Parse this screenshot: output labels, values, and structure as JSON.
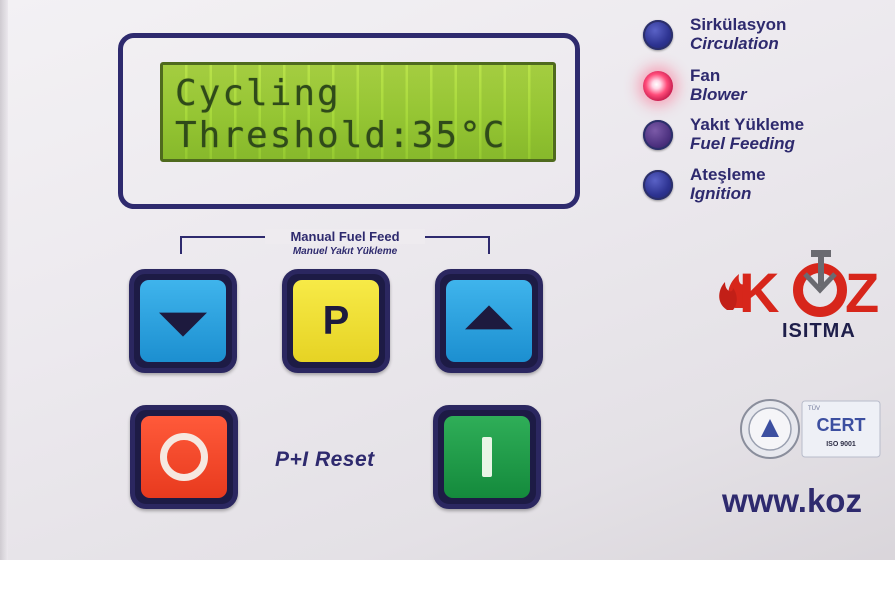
{
  "lcd": {
    "line1": "Cycling",
    "line2": "Threshold:35°C"
  },
  "indicators": [
    {
      "tr": "Sirkülasyon",
      "en": "Circulation",
      "state": "off",
      "color": "#2d3391"
    },
    {
      "tr": "Fan",
      "en": "Blower",
      "state": "on",
      "color": "#ff4c7a"
    },
    {
      "tr": "Yakıt Yükleme",
      "en": "Fuel Feeding",
      "state": "off",
      "color": "#4a2f7d"
    },
    {
      "tr": "Ateşleme",
      "en": "Ignition",
      "state": "off",
      "color": "#2d3391"
    }
  ],
  "manual_feed": {
    "title": "Manual Fuel Feed",
    "subtitle": "Manuel Yakıt Yükleme"
  },
  "buttons": {
    "down": {
      "icon": "triangle-down-icon",
      "color": "#1c8fd0"
    },
    "program": {
      "label": "P",
      "color": "#e6d324"
    },
    "up": {
      "icon": "triangle-up-icon",
      "color": "#1c8fd0"
    },
    "off": {
      "icon": "circle-off-icon",
      "color": "#e83a1e"
    },
    "on": {
      "icon": "bar-on-icon",
      "color": "#148a3c"
    }
  },
  "reset_label": "P+I  Reset",
  "brand": {
    "logo": "KOZ",
    "subtitle": "ISITMA",
    "website": "www.koz",
    "cert_label": "CERT",
    "cert_standard": "ISO 9001",
    "brand_color": "#d7261b"
  }
}
